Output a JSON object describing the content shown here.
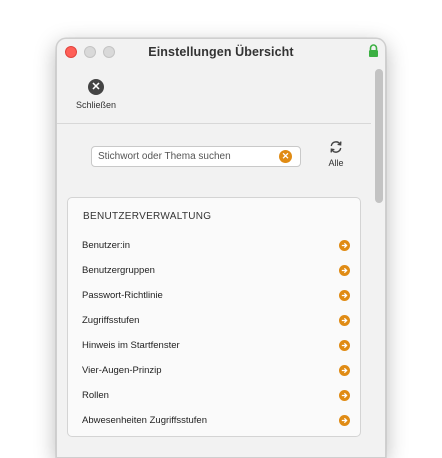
{
  "window": {
    "title": "Einstellungen Übersicht"
  },
  "toolbar": {
    "close_label": "Schließen"
  },
  "search": {
    "placeholder": "Stichwort oder Thema suchen",
    "all_label": "Alle"
  },
  "section": {
    "title": "BENUTZERVERWALTUNG",
    "items": [
      "Benutzer:in",
      "Benutzergruppen",
      "Passwort-Richtlinie",
      "Zugriffsstufen",
      "Hinweis im Startfenster",
      "Vier-Augen-Prinzip",
      "Rollen",
      "Abwesenheiten Zugriffsstufen"
    ]
  },
  "colors": {
    "accent": "#e08b14",
    "close_dot": "#ff5f57",
    "lock": "#3cb043"
  },
  "icons": {
    "close": "close-icon",
    "refresh": "refresh-icon",
    "arrow": "arrow-right-icon",
    "lock": "lock-icon"
  }
}
